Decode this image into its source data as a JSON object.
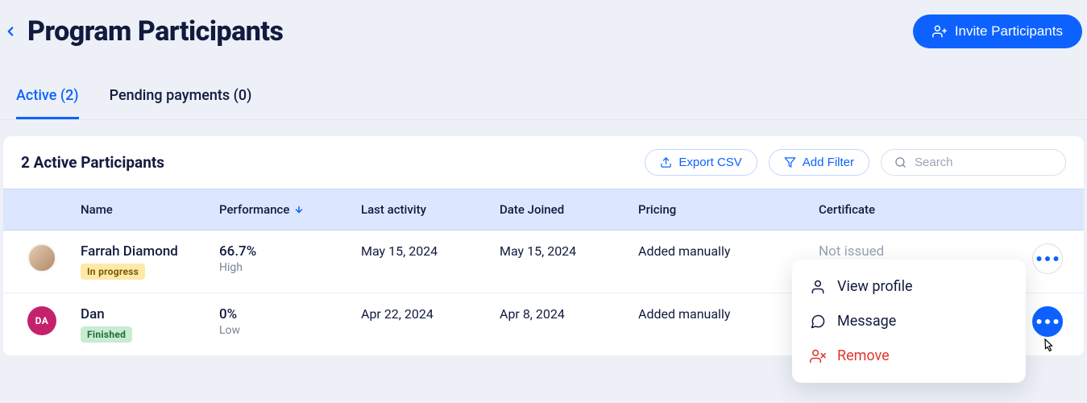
{
  "header": {
    "title": "Program Participants",
    "invite_label": "Invite Participants"
  },
  "tabs": [
    {
      "label": "Active (2)",
      "active": true
    },
    {
      "label": "Pending payments (0)",
      "active": false
    }
  ],
  "panel": {
    "title": "2 Active Participants",
    "export_label": "Export CSV",
    "filter_label": "Add Filter",
    "search_placeholder": "Search"
  },
  "columns": {
    "name": "Name",
    "performance": "Performance",
    "last_activity": "Last activity",
    "date_joined": "Date Joined",
    "pricing": "Pricing",
    "certificate": "Certificate"
  },
  "rows": [
    {
      "name": "Farrah Diamond",
      "status_label": "In progress",
      "status_class": "in-progress",
      "avatar_type": "image",
      "avatar_initials": "",
      "performance_value": "66.7%",
      "performance_label": "High",
      "last_activity": "May 15, 2024",
      "date_joined": "May 15, 2024",
      "pricing": "Added manually",
      "certificate": "Not issued"
    },
    {
      "name": "Dan",
      "status_label": "Finished",
      "status_class": "finished",
      "avatar_type": "initials",
      "avatar_initials": "DA",
      "performance_value": "0%",
      "performance_label": "Low",
      "last_activity": "Apr 22, 2024",
      "date_joined": "Apr 8, 2024",
      "pricing": "Added manually",
      "certificate": ""
    }
  ],
  "dropdown": {
    "view_profile": "View profile",
    "message": "Message",
    "remove": "Remove"
  }
}
